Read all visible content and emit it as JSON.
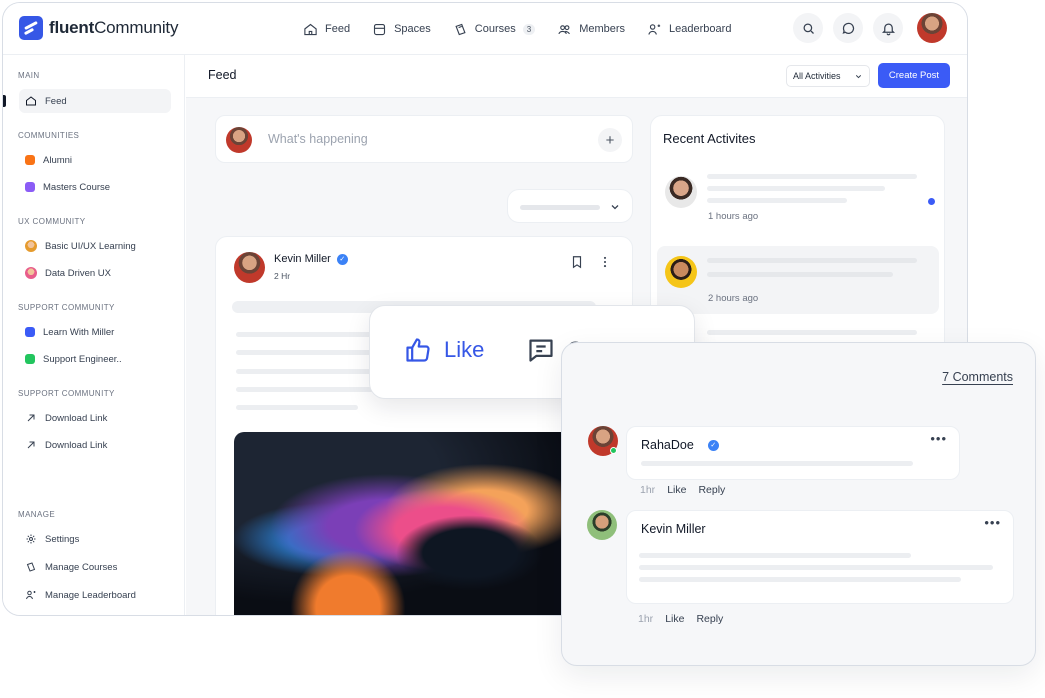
{
  "brand": {
    "name_bold": "fluent",
    "name_rest": "Community"
  },
  "nav": [
    {
      "label": "Feed",
      "icon": "home-icon"
    },
    {
      "label": "Spaces",
      "icon": "spaces-icon"
    },
    {
      "label": "Courses",
      "icon": "courses-icon",
      "badge": "3"
    },
    {
      "label": "Members",
      "icon": "members-icon"
    },
    {
      "label": "Leaderboard",
      "icon": "leaderboard-icon"
    }
  ],
  "sidebar": {
    "main_title": "MAIN",
    "feed_label": "Feed",
    "communities_title": "COMMUNITIES",
    "communities": [
      {
        "label": "Alumni",
        "color": "#f97316"
      },
      {
        "label": "Masters Course",
        "color": "#8b5cf6"
      }
    ],
    "ux_title": "UX COMMUNITY",
    "ux_items": [
      {
        "label": "Basic UI/UX Learning"
      },
      {
        "label": "Data Driven UX"
      }
    ],
    "support_title": "SUPPORT COMMUNITY",
    "support_items": [
      {
        "label": "Learn With Miller",
        "color": "#3b5bf6"
      },
      {
        "label": "Support Engineer..",
        "color": "#22c55e"
      }
    ],
    "support2_title": "SUPPORT COMMUNITY",
    "links": [
      {
        "label": "Download Link"
      },
      {
        "label": "Download Link"
      }
    ],
    "manage_title": "MANAGE",
    "manage": [
      {
        "label": "Settings"
      },
      {
        "label": "Manage Courses"
      },
      {
        "label": "Manage Leaderboard"
      }
    ]
  },
  "main": {
    "title": "Feed",
    "filter_label": "All Activities",
    "create_label": "Create Post",
    "composer_placeholder": "What's happening",
    "post": {
      "author": "Kevin Miller",
      "time": "2 Hr"
    }
  },
  "activity": {
    "title": "Recent Activites",
    "items": [
      {
        "time": "1 hours ago"
      },
      {
        "time": "2 hours ago"
      }
    ]
  },
  "reaction": {
    "like": "Like",
    "comment": "Comment"
  },
  "comments": {
    "count_label": "7 Comments",
    "items": [
      {
        "name": "RahaDoe",
        "time": "1hr",
        "like": "Like",
        "reply": "Reply"
      },
      {
        "name": "Kevin Miller",
        "time": "1hr",
        "like": "Like",
        "reply": "Reply"
      }
    ]
  },
  "colors": {
    "accent": "#3b5bf6",
    "brand": "#3657e6",
    "online": "#22c55e"
  }
}
